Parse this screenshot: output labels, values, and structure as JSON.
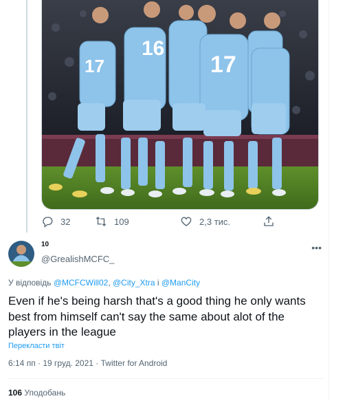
{
  "image_alt": "",
  "tweet_actions": {
    "replies": "32",
    "retweets": "109",
    "likes": "2,3 тис.",
    "icons": [
      "reply-icon",
      "retweet-icon",
      "like-icon",
      "share-icon"
    ]
  },
  "reply": {
    "display_name": "10",
    "handle": "@GrealishMCFC_",
    "more_icon": "more-icon",
    "replying_label": "У відповідь",
    "mentions": [
      "@MCFCWill02",
      "@City_Xtra",
      "@ManCity"
    ],
    "mention_sep_1": ", ",
    "mention_sep_2": " і ",
    "text": "Even if he's being harsh that's a good thing he only wants best from himself can't say the same about alot of the players in the league",
    "translate_label": "Перекласти твіт",
    "time": "6:14 пп",
    "date": "19 груд. 2021",
    "source": "Twitter for Android",
    "like_count": "106",
    "like_label": "Уподобань"
  },
  "colors": {
    "accent": "#1d9bf0",
    "secondary_text": "#536471",
    "primary_text": "#0f1419",
    "city_blue": "#8ec3ea"
  }
}
